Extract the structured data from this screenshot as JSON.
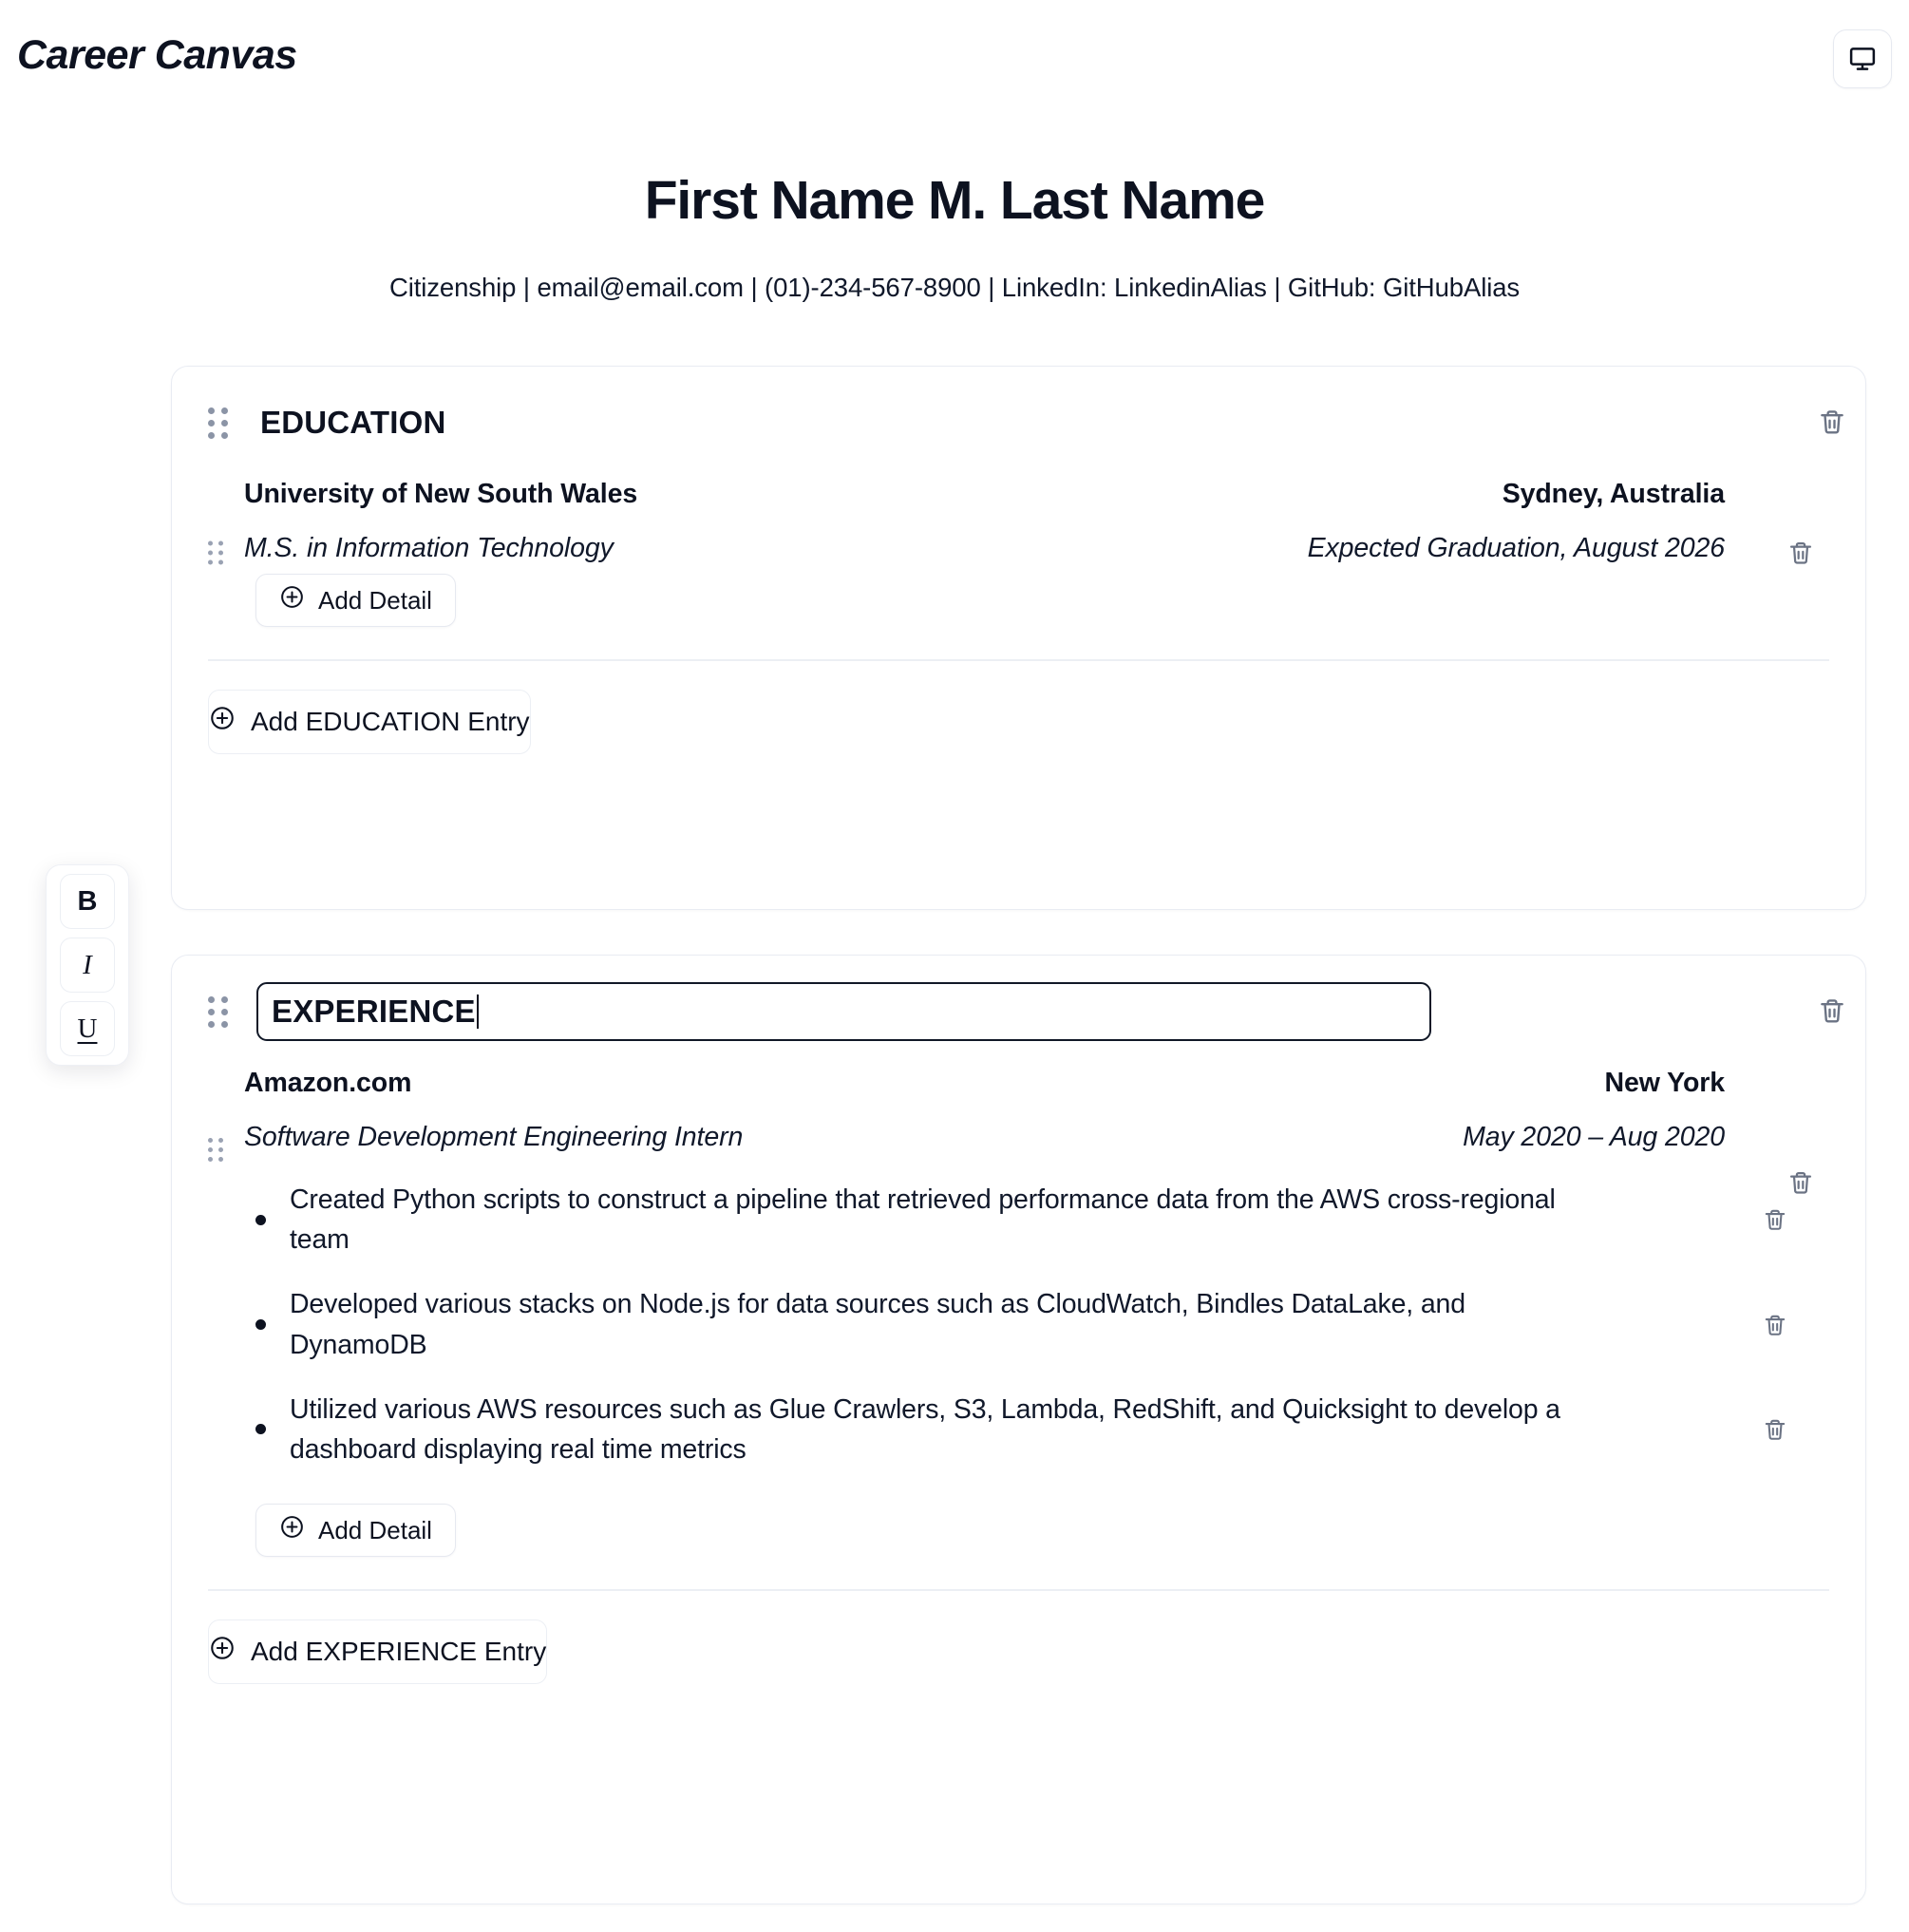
{
  "app": {
    "brand": "Career Canvas",
    "preview_icon": "monitor-icon"
  },
  "resume_header": {
    "name": "First Name M. Last Name",
    "contact": "Citizenship | email@email.com | (01)-234-567-8900 | LinkedIn: LinkedinAlias | GitHub: GitHubAlias"
  },
  "format_toolbar": {
    "bold_label": "B",
    "italic_label": "I",
    "underline_label": "U"
  },
  "sections": [
    {
      "title": "EDUCATION",
      "editing": false,
      "add_entry_label": "Add EDUCATION Entry",
      "entries": [
        {
          "org": "University of New South Wales",
          "place": "Sydney, Australia",
          "role": "M.S. in Information Technology",
          "dates": "Expected Graduation, August 2026",
          "bullets": [],
          "add_detail_label": "Add Detail"
        }
      ]
    },
    {
      "title": "EXPERIENCE",
      "editing": true,
      "add_entry_label": "Add EXPERIENCE Entry",
      "entries": [
        {
          "org": "Amazon.com",
          "place": "New York",
          "role": "Software Development Engineering Intern",
          "dates": "May 2020 – Aug 2020",
          "bullets": [
            "Created Python scripts to construct a pipeline that retrieved performance data from the AWS cross-regional team",
            "Developed various stacks on Node.js for data sources such as CloudWatch, Bindles DataLake, and DynamoDB",
            "Utilized various AWS resources such as Glue Crawlers, S3, Lambda, RedShift, and Quicksight to develop a dashboard displaying real time metrics"
          ],
          "add_detail_label": "Add Detail"
        }
      ]
    }
  ],
  "colors": {
    "text": "#0d1220",
    "muted_icon": "#6b7384",
    "border": "#e9ecf3",
    "drag_dot": "#8b94a6"
  }
}
